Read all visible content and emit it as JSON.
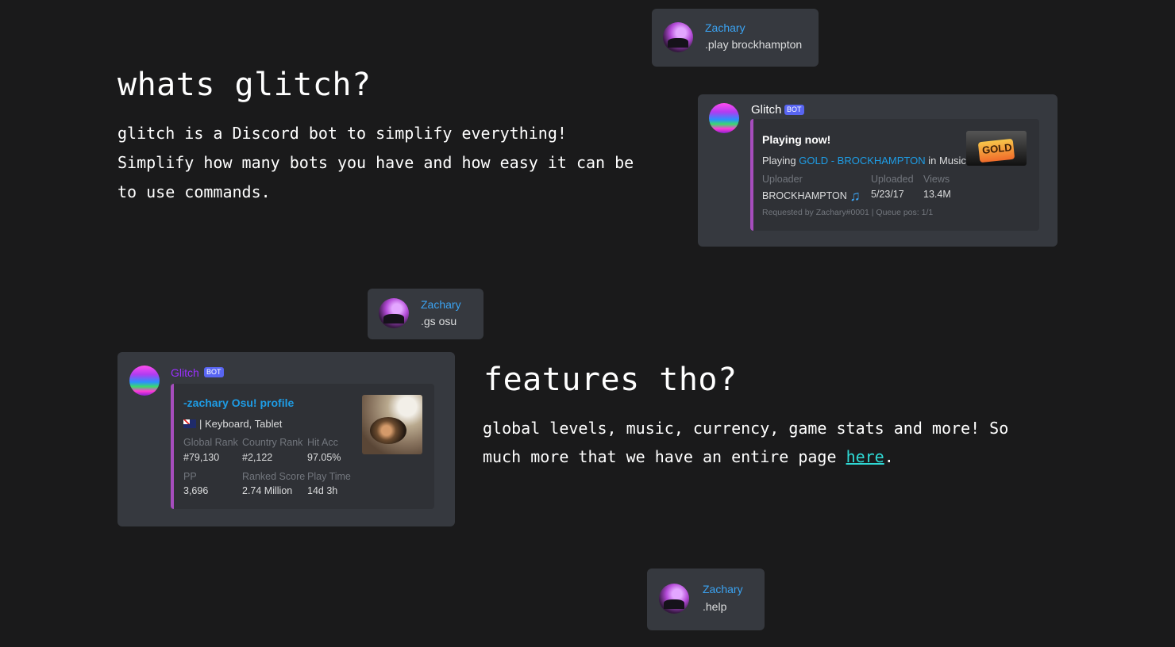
{
  "intro": {
    "heading": "whats glitch?",
    "text": "glitch is a Discord bot to simplify everything! Simplify how many bots you have and how easy it can be to use commands."
  },
  "features": {
    "heading": "features tho?",
    "text_before": "global levels, music, currency, game stats and more! So much more that we have an entire page ",
    "link": "here",
    "text_after": "."
  },
  "cmd_play": {
    "user": "Zachary",
    "message": ".play brockhampton"
  },
  "music_embed": {
    "bot_name": "Glitch",
    "bot_tag": "BOT",
    "title": "Playing now!",
    "playing_prefix": "Playing ",
    "song_link": "GOLD - BROCKHAMPTON",
    "playing_suffix": " in Music",
    "fields": [
      {
        "name": "Uploader",
        "value": "BROCKHAMPTON"
      },
      {
        "name": "Uploaded",
        "value": "5/23/17"
      },
      {
        "name": "Views",
        "value": "13.4M"
      }
    ],
    "footer": "Requested by Zachary#0001 | Queue pos: 1/1",
    "thumb_text": "GOLD",
    "note_icon": "music-note-icon"
  },
  "cmd_osu": {
    "user": "Zachary",
    "message": ".gs osu"
  },
  "osu_embed": {
    "bot_name": "Glitch",
    "bot_tag": "BOT",
    "title": "-zachary Osu! profile",
    "subtitle": "| Keyboard, Tablet",
    "fields": [
      {
        "name": "Global Rank",
        "value": "#79,130"
      },
      {
        "name": "Country Rank",
        "value": "#2,122"
      },
      {
        "name": "Hit Acc",
        "value": "97.05%"
      },
      {
        "name": "PP",
        "value": "3,696"
      },
      {
        "name": "Ranked Score",
        "value": "2.74 Million"
      },
      {
        "name": "Play Time",
        "value": "14d 3h"
      }
    ]
  },
  "cmd_help": {
    "user": "Zachary",
    "message": ".help"
  },
  "colors": {
    "background": "#1a1a1b",
    "bubble": "#36393f",
    "embed": "#2f3136",
    "embed_accent": "#a64dbd",
    "username": "#3ba3f2",
    "link": "#2fd9d5"
  }
}
